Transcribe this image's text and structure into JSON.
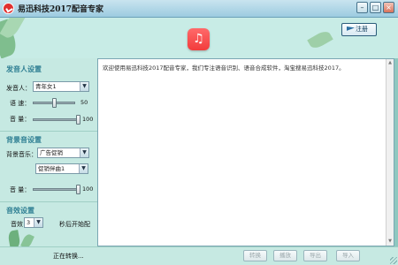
{
  "window": {
    "title": "易迅科技2017配音专家",
    "minimize_glyph": "–",
    "maximize_glyph": "□",
    "close_glyph": "×"
  },
  "header": {
    "register_label": "注册",
    "music_icon_glyph": "♫"
  },
  "voice_settings": {
    "title": "发音人设置",
    "speaker_label": "发音人：",
    "speaker_value": "青年女1",
    "speed_label": "语 速：",
    "speed_value": "50",
    "speed_fraction": 0.5,
    "volume_label": "音 量：",
    "volume_value": "100",
    "volume_fraction": 1.0
  },
  "bg_settings": {
    "title": "背景音设置",
    "music_label": "背景音乐：",
    "category_value": "广告促销",
    "track_value": "促销伴曲1",
    "volume_label": "音 量：",
    "volume_value": "100",
    "volume_fraction": 1.0
  },
  "effect_settings": {
    "title": "音效设置",
    "effect_label": "音效",
    "effect_value": "3",
    "delay_label": "秒后开始配"
  },
  "text_area": {
    "content": "欢迎使用易迅科技2017配音专家，我们专注语音识别、语音合成软件，淘宝搜易迅科技2017。"
  },
  "bottom_bar": {
    "status": "正在转换...",
    "buttons": [
      "转换",
      "播放",
      "导出",
      "导入"
    ]
  },
  "colors": {
    "panel_bg": "#c6e9e2",
    "header_bg": "#c8ece6",
    "accent_title": "#2f7f93",
    "music_button": "#f23c3c"
  }
}
